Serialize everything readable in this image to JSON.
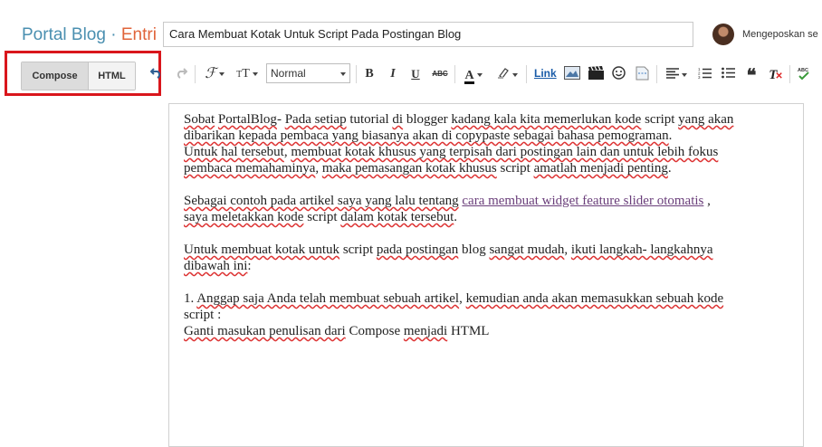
{
  "header": {
    "brand_name": "Portal Blog",
    "brand_separator": "·",
    "brand_section": "Entri",
    "post_title": "Cara Membuat Kotak Untuk Script Pada Postingan Blog",
    "posting_as": "Mengeposkan se"
  },
  "toolbar": {
    "compose_label": "Compose",
    "html_label": "HTML",
    "font_size_value": "Normal",
    "link_label": "Link",
    "colors": {
      "highlight_border": "#d9161c",
      "brand_blue": "#4a8fb0",
      "brand_orange": "#e0643a",
      "link_blue": "#1a5ca8"
    },
    "icons": [
      "undo-icon",
      "redo-icon",
      "font-family-icon",
      "font-size-icon",
      "bold-icon",
      "italic-icon",
      "underline-icon",
      "strikethrough-icon",
      "text-color-icon",
      "highlight-color-icon",
      "image-icon",
      "video-icon",
      "emoji-icon",
      "jump-break-icon",
      "align-icon",
      "numbered-list-icon",
      "bulleted-list-icon",
      "quote-icon",
      "clear-formatting-icon",
      "spellcheck-icon"
    ]
  },
  "editor": {
    "p1_l1_a": "Sobat",
    "p1_l1_b": "PortalBlog",
    "p1_l1_c": "- ",
    "p1_l1_d": "Pada setiap",
    "p1_l1_e": " tutorial ",
    "p1_l1_f": "di",
    "p1_l1_g": " blogger ",
    "p1_l1_h": "kadang kala kita memerlukan kode",
    "p1_l1_i": " script ",
    "p1_l1_j": "yang akan",
    "p1_l2_a": "dibarikan kepada pembaca yang biasanya akan di copypaste sebagai bahasa pemograman",
    "p1_l2_b": ".",
    "p1_l3_a": "Untuk hal tersebut",
    "p1_l3_b": ", ",
    "p1_l3_c": "membuat kotak khusus yang terpisah dari postingan lain dan untuk lebih fokus",
    "p1_l4_a": "pembaca memahaminya",
    "p1_l4_b": ", ",
    "p1_l4_c": "maka pemasangan kotak khusus",
    "p1_l4_d": " script ",
    "p1_l4_e": "amatlah menjadi penting",
    "p1_l4_f": ".",
    "p2_a": "Sebagai contoh pada artikel saya yang lalu tentang",
    "p2_link": "cara membuat widget feature slider otomatis",
    "p2_b": " ,",
    "p2_l2_a": "saya meletakkan kode",
    "p2_l2_b": " script ",
    "p2_l2_c": "dalam kotak tersebut",
    "p2_l2_d": ".",
    "p3_a": "Untuk membuat kotak untuk",
    "p3_b": " script ",
    "p3_c": "pada postingan",
    "p3_d": " blog ",
    "p3_e": "sangat mudah",
    "p3_f": ", ",
    "p3_g": "ikuti langkah- langkahnya",
    "p3_l2_a": "dibawah ini",
    "p3_l2_b": ":",
    "p4_a": "1. ",
    "p4_b": "Anggap saja Anda telah membuat sebuah artikel",
    "p4_c": ", ",
    "p4_d": "kemudian anda akan memasukkan sebuah kode",
    "p4_l2": "script :",
    "p4_l3_a": "Ganti masukan penulisan dari",
    "p4_l3_b": " Compose ",
    "p4_l3_c": "menjadi",
    "p4_l3_d": " HTML"
  }
}
